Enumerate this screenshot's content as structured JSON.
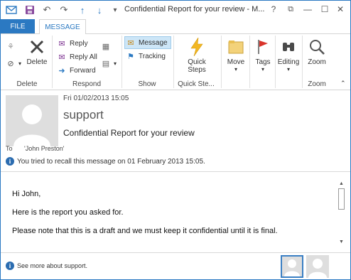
{
  "window": {
    "title": "Confidential Report for your review - M...",
    "qat": {
      "save_icon": "save-icon",
      "undo_icon": "undo-icon",
      "redo_icon": "redo-icon",
      "up_icon": "arrow-up-icon",
      "down_icon": "arrow-down-icon"
    },
    "controls": {
      "help": "?",
      "restore": "⧉",
      "minimize": "—",
      "maximize": "☐",
      "close": "✕"
    }
  },
  "tabs": {
    "file": "FILE",
    "message": "MESSAGE"
  },
  "ribbon": {
    "delete_group": {
      "label": "Delete",
      "delete_button": "Delete"
    },
    "respond_group": {
      "label": "Respond",
      "reply": "Reply",
      "reply_all": "Reply All",
      "forward": "Forward"
    },
    "show_group": {
      "label": "Show",
      "message": "Message",
      "tracking": "Tracking"
    },
    "quick_steps_group": {
      "label": "Quick Ste...",
      "button_line1": "Quick",
      "button_line2": "Steps"
    },
    "move": "Move",
    "tags": "Tags",
    "editing": "Editing",
    "zoom_group": {
      "label": "Zoom",
      "zoom": "Zoom"
    }
  },
  "header": {
    "date": "Fri 01/02/2013 15:05",
    "sender": "support",
    "subject": "Confidential Report for your review",
    "to_label": "To",
    "to_name": "'John Preston'",
    "info": "You tried to recall this message on 01 February 2013 15:05."
  },
  "body": {
    "lines": [
      "Hi John,",
      "Here is the report you asked for.",
      "Please note that this is a draft and we must keep it confidential until it is final."
    ]
  },
  "footer": {
    "text": "See more about support."
  },
  "colors": {
    "accent": "#2b79c2",
    "info": "#2b6cb0",
    "avatar_bg": "#dedede",
    "avatar_fg": "#ffffff"
  }
}
